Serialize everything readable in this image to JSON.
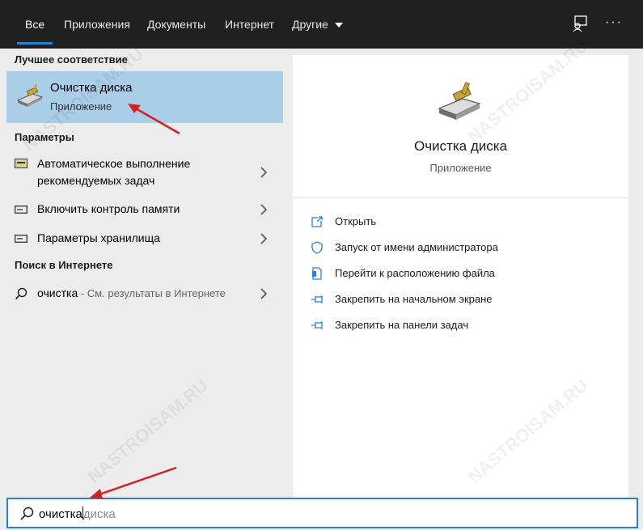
{
  "tabs": [
    {
      "label": "Все",
      "active": true
    },
    {
      "label": "Приложения"
    },
    {
      "label": "Документы"
    },
    {
      "label": "Интернет"
    },
    {
      "label": "Другие"
    }
  ],
  "icons": {
    "feedback": "feedback-icon",
    "more": "more-icon"
  },
  "left": {
    "best_match_title": "Лучшее соответствие",
    "best_match": {
      "name": "Очистка диска",
      "type": "Приложение",
      "icon": "disk-cleanup-icon"
    },
    "settings_title": "Параметры",
    "settings": [
      {
        "line1": "Автоматическое выполнение",
        "line2": "рекомендуемых задач",
        "icon": "maintenance-icon"
      },
      {
        "label": "Включить контроль памяти",
        "icon": "storage-icon"
      },
      {
        "label": "Параметры хранилища",
        "icon": "storage-icon"
      }
    ],
    "web_title": "Поиск в Интернете",
    "web": {
      "query": "очистка",
      "suffix": " - См. результаты в Интернете",
      "icon": "search-icon"
    }
  },
  "right": {
    "app_name": "Очистка диска",
    "app_type": "Приложение",
    "actions": [
      {
        "label": "Открыть",
        "icon": "open-icon"
      },
      {
        "label": "Запуск от имени администратора",
        "icon": "run-as-admin-icon"
      },
      {
        "label": "Перейти к расположению файла",
        "icon": "file-location-icon"
      },
      {
        "label": "Закрепить на начальном экране",
        "icon": "pin-icon"
      },
      {
        "label": "Закрепить на панели задач",
        "icon": "pin-icon"
      }
    ]
  },
  "search": {
    "typed": "очистка",
    "suggestion": "диска"
  },
  "watermark": "NASTROISAM.RU",
  "colors": {
    "accent": "#2b7fd3",
    "selected": "#aacde8",
    "topbar": "#202020",
    "annotation": "#d6201e"
  }
}
